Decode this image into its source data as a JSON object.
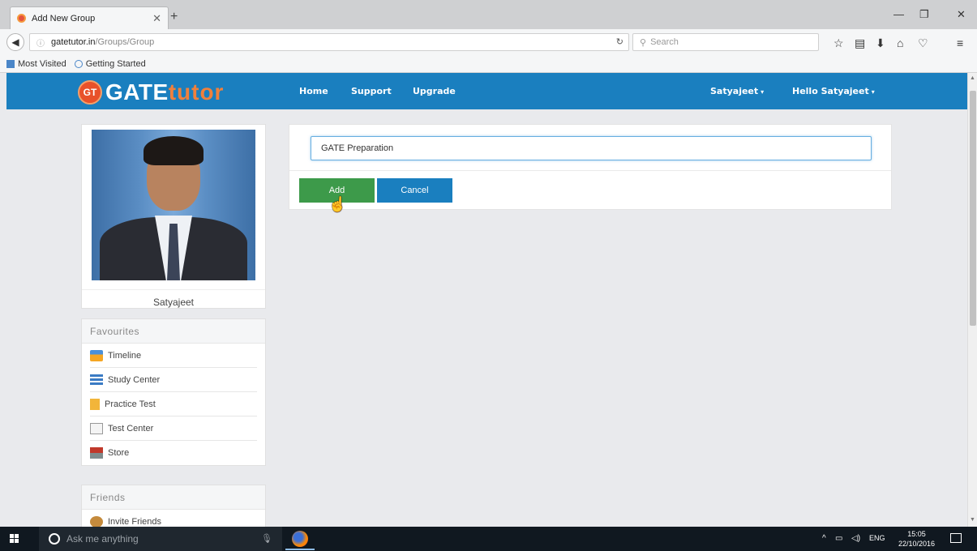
{
  "browser": {
    "tab_title": "Add New Group",
    "url_host": "gatetutor.in",
    "url_path": "/Groups/Group",
    "search_placeholder": "Search",
    "bookmarks": [
      "Most Visited",
      "Getting Started"
    ]
  },
  "site": {
    "logo_badge": "GT",
    "logo_gate": "GATE",
    "logo_tutor": "tutor",
    "nav": [
      "Home",
      "Support",
      "Upgrade"
    ],
    "user_menu": "Satyajeet",
    "greeting_menu": "Hello Satyajeet"
  },
  "profile": {
    "name": "Satyajeet"
  },
  "favourites": {
    "title": "Favourites",
    "items": [
      "Timeline",
      "Study Center",
      "Practice Test",
      "Test Center",
      "Store"
    ]
  },
  "friends": {
    "title": "Friends",
    "items": [
      "Invite Friends"
    ]
  },
  "form": {
    "group_name_value": "GATE Preparation",
    "add_label": "Add",
    "cancel_label": "Cancel"
  },
  "taskbar": {
    "search_text": "Ask me anything",
    "lang": "ENG",
    "time": "15:05",
    "date": "22/10/2016"
  },
  "colors": {
    "header_blue": "#1a7fbf",
    "add_green": "#3d9a4a",
    "logo_orange": "#f0803c"
  }
}
